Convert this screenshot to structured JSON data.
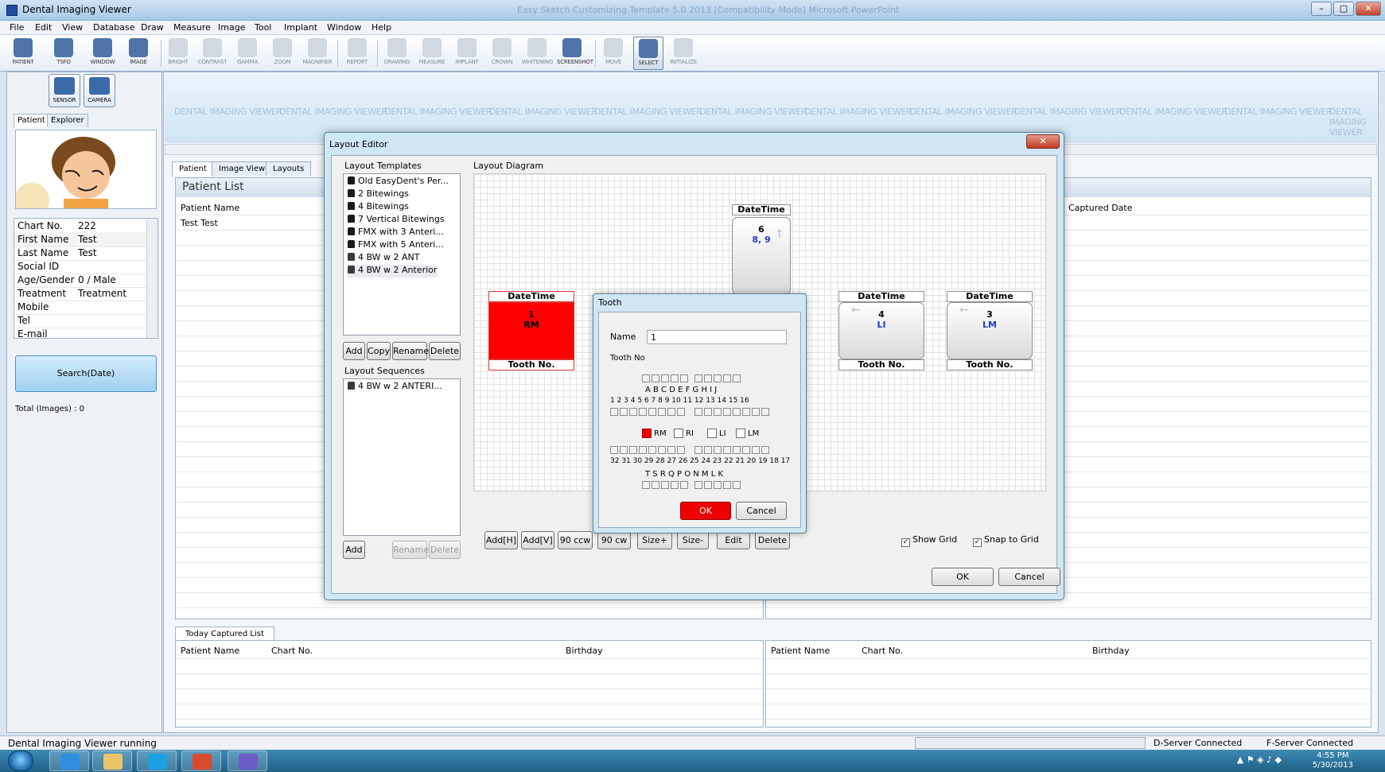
{
  "window": {
    "title": "Dental Imaging Viewer",
    "background_title": "Easy Sketch Customizing Template 5.0 2013 [Compatibility Mode] Microsoft PowerPoint",
    "min": "–",
    "max": "□",
    "close": "✕"
  },
  "menu": [
    "File",
    "Edit",
    "View",
    "Database",
    "Draw",
    "Measure",
    "Image",
    "Tool",
    "Implant",
    "Window",
    "Help"
  ],
  "toolbar": {
    "patient": "PATIENT",
    "tsfo": "TSFO",
    "window": "WINDOW",
    "image": "IMAGE",
    "bright": "BRIGHT",
    "contrast": "CONTRAST",
    "gamma": "GAMMA",
    "zoom": "ZOOM",
    "magnifier": "MAGNIFIER",
    "report": "REPORT",
    "drawing": "DRAWING",
    "measure": "MEASURE",
    "implant": "IMPLANT",
    "crown": "CROWN",
    "whitening": "WHITENING",
    "screenshot": "SCREENSHOT",
    "move": "MOVE",
    "select": "SELECT",
    "initialize": "INITIALIZE"
  },
  "left": {
    "sensor": "SENSOR",
    "camera": "CAMERA",
    "tab_patient": "Patient",
    "tab_explorer": "Explorer",
    "info": [
      {
        "k": "Chart No.",
        "v": "222"
      },
      {
        "k": "First Name",
        "v": "Test"
      },
      {
        "k": "Last Name",
        "v": "Test"
      },
      {
        "k": "Social ID",
        "v": ""
      },
      {
        "k": "Age/Gender",
        "v": "0 / Male"
      },
      {
        "k": "Treatment",
        "v": "Treatment"
      },
      {
        "k": "Mobile",
        "v": ""
      },
      {
        "k": "Tel",
        "v": ""
      },
      {
        "k": "E-mail",
        "v": ""
      }
    ],
    "search_label": "Search(Date)",
    "total_images": "Total (Images) : 0"
  },
  "main": {
    "watermark": "DENTAL IMAGING VIEWER",
    "tabs": [
      "Patient",
      "Image View",
      "Layouts"
    ],
    "patient_list_title": "Patient List",
    "col_patient_name": "Patient Name",
    "col_captured_date": "Captured Date",
    "rows": [
      {
        "name": "Test Test"
      }
    ],
    "today_tab": "Today Captured List",
    "bottom_cols": [
      "Patient Name",
      "Chart No.",
      "Birthday"
    ]
  },
  "layout_editor": {
    "title": "Layout Editor",
    "close": "✕",
    "templates_label": "Layout Templates",
    "templates": [
      {
        "name": "Old EasyDent's Per...",
        "locked": true
      },
      {
        "name": "2 Bitewings",
        "locked": true
      },
      {
        "name": "4 Bitewings",
        "locked": true
      },
      {
        "name": "7 Vertical Bitewings",
        "locked": true
      },
      {
        "name": "FMX with 3 Anteri...",
        "locked": true
      },
      {
        "name": "FMX with 5 Anteri...",
        "locked": true
      },
      {
        "name": "4 BW w 2 ANT",
        "locked": false
      },
      {
        "name": "4 BW w 2 Anterior",
        "locked": false
      }
    ],
    "tpl_buttons": {
      "add": "Add",
      "copy": "Copy",
      "rename": "Rename",
      "delete": "Delete"
    },
    "sequences_label": "Layout Sequences",
    "sequences": [
      {
        "name": "4 BW w 2 ANTERI...",
        "locked": false
      }
    ],
    "seq_buttons": {
      "add": "Add",
      "rename": "Rename",
      "delete": "Delete"
    },
    "diagram_label": "Layout Diagram",
    "slots": [
      {
        "top_label": "DateTime",
        "name": "6",
        "teeth": "8, 9",
        "bottom_label": ""
      },
      {
        "top_label": "DateTime",
        "name": "1",
        "teeth": "RM",
        "bottom_label": "Tooth No."
      },
      {
        "top_label": "DateTime",
        "name": "4",
        "teeth": "LI",
        "bottom_label": "Tooth No."
      },
      {
        "top_label": "DateTime",
        "name": "3",
        "teeth": "LM",
        "bottom_label": "Tooth No."
      }
    ],
    "diagram_buttons": [
      "Add[H]",
      "Add[V]",
      "90 ccw",
      "90 cw",
      "Size+",
      "Size-",
      "Edit",
      "Delete"
    ],
    "show_grid": "Show Grid",
    "snap_to_grid": "Snap to Grid",
    "check_mark": "✓",
    "ok": "OK",
    "cancel": "Cancel"
  },
  "tooth_dialog": {
    "title": "Tooth",
    "name_label": "Name",
    "name_value": "1",
    "tooth_no_label": "Tooth No",
    "primary_upper": "A B C D E   F G H I J",
    "permanent_upper": "1 2 3 4 5 6 7 8   9 10 11 12 13 14 15 16",
    "quadrants": [
      {
        "label": "RM",
        "checked": true
      },
      {
        "label": "RI",
        "checked": false
      },
      {
        "label": "LI",
        "checked": false
      },
      {
        "label": "LM",
        "checked": false
      }
    ],
    "permanent_lower": "32 31 30 29 28 27 26 25   24 23 22 21 20 19 18 17",
    "primary_lower": "T S R Q P   O N M L K",
    "ok": "OK",
    "cancel": "Cancel"
  },
  "statusbar": {
    "text": "Dental Imaging Viewer running",
    "dserver": "D-Server Connected",
    "fserver": "F-Server Connected"
  },
  "taskbar": {
    "time": "4:55 PM",
    "date": "5/30/2013"
  },
  "colors": {
    "red_slot": "#ff0000",
    "tooth_blue": "#1f3dcc",
    "dialog_frame": "#cfe6f3"
  }
}
